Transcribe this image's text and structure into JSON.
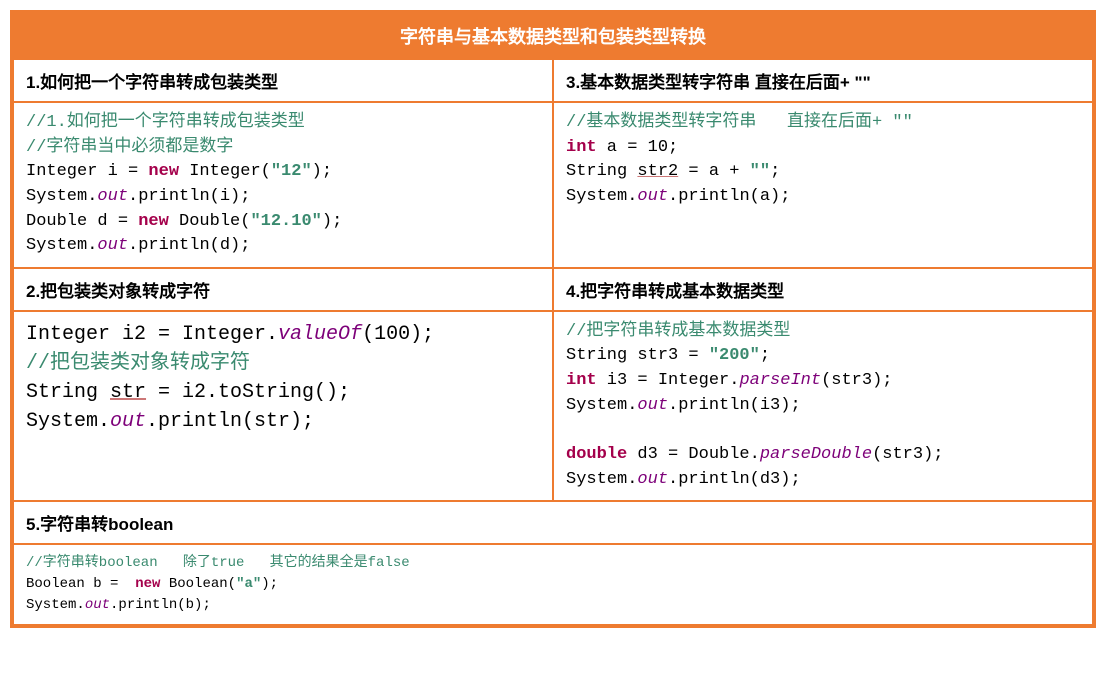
{
  "title": "字符串与基本数据类型和包装类型转换",
  "sections": {
    "s1": {
      "heading": "1.如何把一个字符串转成包装类型",
      "code": {
        "c1": "//1.如何把一个字符串转成包装类型",
        "c2": "//字符串当中必须都是数字",
        "l1a": "Integer i = ",
        "l1b": "new",
        "l1c": " Integer(",
        "l1d": "\"12\"",
        "l1e": ");",
        "l2a": "System.",
        "l2b": "out",
        "l2c": ".println(i);",
        "l3a": "Double d = ",
        "l3b": "new",
        "l3c": " Double(",
        "l3d": "\"12.10\"",
        "l3e": ");",
        "l4a": "System.",
        "l4b": "out",
        "l4c": ".println(d);"
      }
    },
    "s2": {
      "heading": "2.把包装类对象转成字符",
      "code": {
        "l1a": "Integer i2 = Integer.",
        "l1b": "valueOf",
        "l1c": "(100);",
        "c1": "//把包装类对象转成字符",
        "l2a": "String ",
        "l2b": "str",
        "l2c": " = i2.toString();",
        "l3a": "System.",
        "l3b": "out",
        "l3c": ".println(str);"
      }
    },
    "s3": {
      "heading": "3.基本数据类型转字符串    直接在后面+ \"\"",
      "code": {
        "c1": "//基本数据类型转字符串   直接在后面+ \"\"",
        "l1a": "int",
        "l1b": " a = 10;",
        "l2a": "String ",
        "l2b": "str2",
        "l2c": " = a + ",
        "l2d": "\"\"",
        "l2e": ";",
        "l3a": "System.",
        "l3b": "out",
        "l3c": ".println(a);"
      }
    },
    "s4": {
      "heading": "4.把字符串转成基本数据类型",
      "code": {
        "c1": "//把字符串转成基本数据类型",
        "l1a": "String str3 = ",
        "l1b": "\"200\"",
        "l1c": ";",
        "l2a": "int",
        "l2b": " i3 = Integer.",
        "l2c": "parseInt",
        "l2d": "(str3);",
        "l3a": "System.",
        "l3b": "out",
        "l3c": ".println(i3);",
        "l4a": "double",
        "l4b": " d3 = Double.",
        "l4c": "parseDouble",
        "l4d": "(str3);",
        "l5a": "System.",
        "l5b": "out",
        "l5c": ".println(d3);"
      }
    },
    "s5": {
      "heading": "5.字符串转boolean",
      "code": {
        "c1a": "//字符串转boolean   除了",
        "c1b": "true",
        "c1c": "   其它的结果全是",
        "c1d": "false",
        "l1a": "Boolean b =  ",
        "l1b": "new",
        "l1c": " Boolean(",
        "l1d": "\"a\"",
        "l1e": ");",
        "l2a": "System.",
        "l2b": "out",
        "l2c": ".println(b);"
      }
    }
  }
}
